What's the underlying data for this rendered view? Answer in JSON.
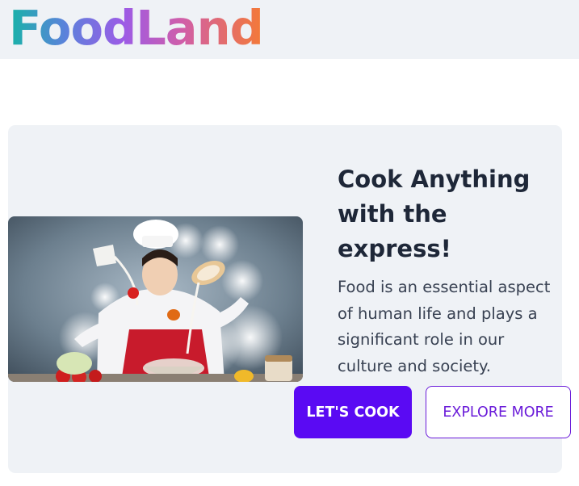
{
  "header": {
    "brand": "FoodLand"
  },
  "hero": {
    "image_alt": "Chef cooking with flying ingredients",
    "title": "Cook Anything with the express!",
    "description": "Food is an essential aspect of human life and plays a significant role in our culture and society.",
    "primary_button": "LET'S COOK",
    "secondary_button": "EXPLORE MORE"
  },
  "colors": {
    "primary": "#5a0af3",
    "outline": "#6a1bd9",
    "card_bg": "#eff2f6",
    "heading": "#1e2738"
  }
}
